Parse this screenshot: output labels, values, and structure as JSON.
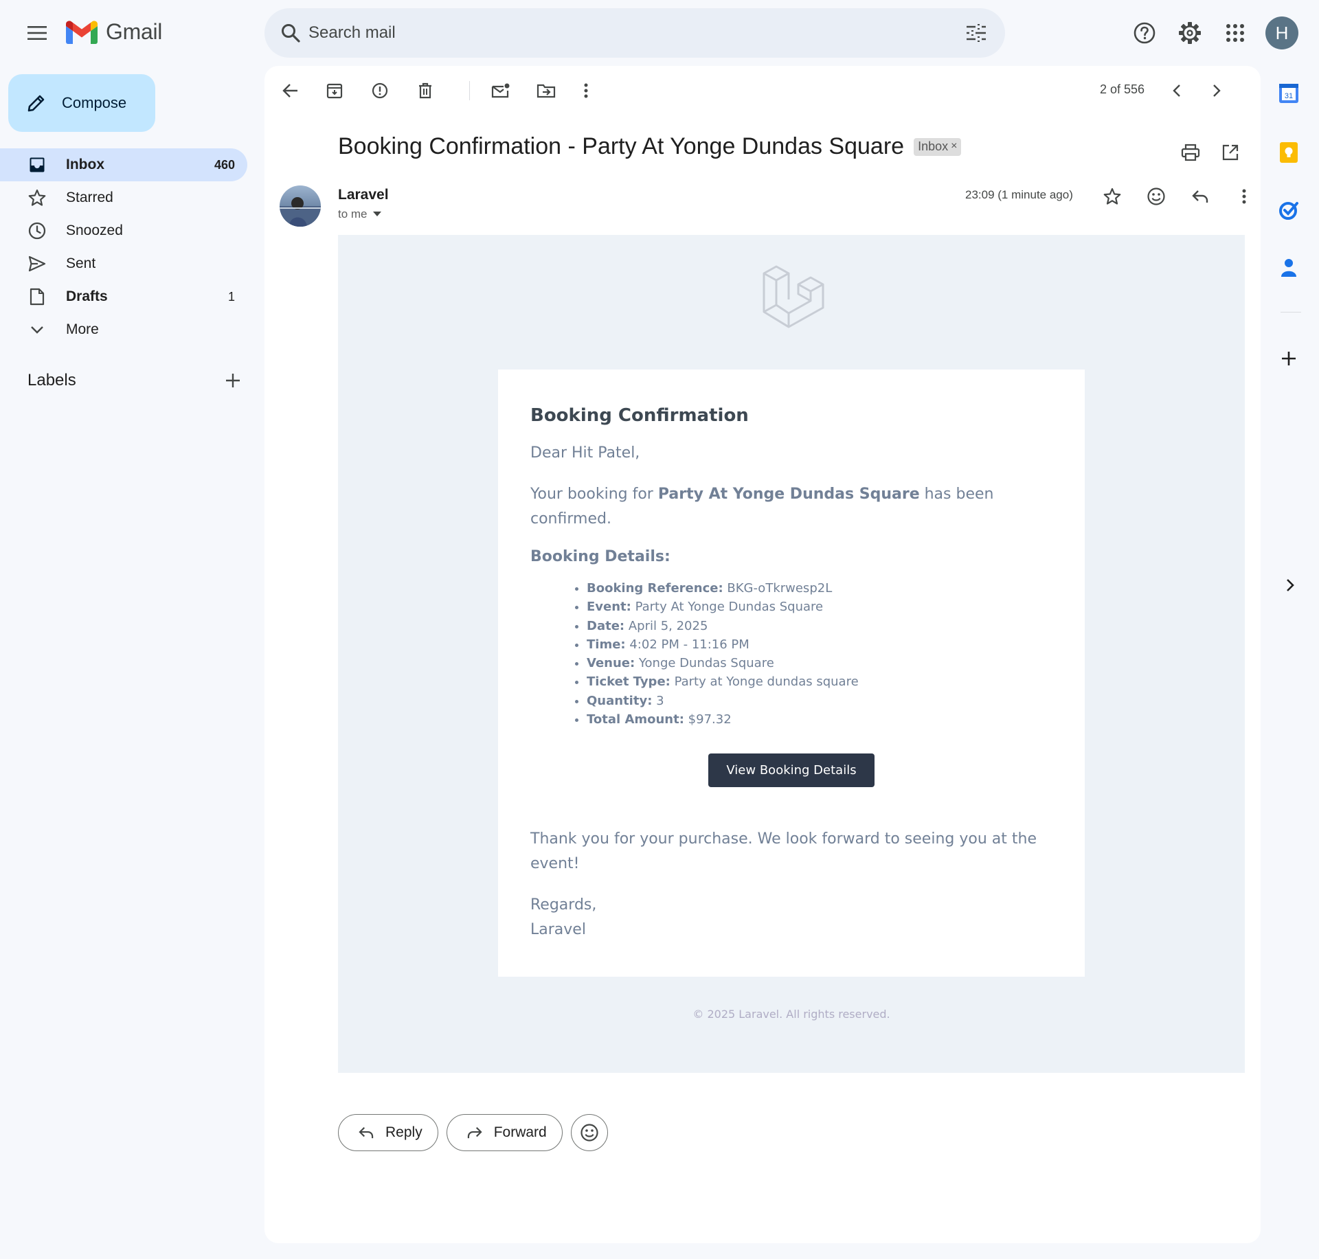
{
  "app": {
    "name": "Gmail"
  },
  "search": {
    "placeholder": "Search mail"
  },
  "account": {
    "initial": "H"
  },
  "compose": {
    "label": "Compose"
  },
  "nav": {
    "items": [
      {
        "label": "Inbox",
        "count": "460"
      },
      {
        "label": "Starred",
        "count": ""
      },
      {
        "label": "Snoozed",
        "count": ""
      },
      {
        "label": "Sent",
        "count": ""
      },
      {
        "label": "Drafts",
        "count": "1"
      },
      {
        "label": "More",
        "count": ""
      }
    ]
  },
  "labels": {
    "title": "Labels"
  },
  "toolbar": {
    "pager": "2 of 556"
  },
  "message": {
    "subject": "Booking Confirmation - Party At Yonge Dundas Square",
    "label_chip": "Inbox",
    "chip_close": "×",
    "sender": "Laravel",
    "to": "to me",
    "time": "23:09 (1 minute ago)"
  },
  "email": {
    "heading": "Booking Confirmation",
    "greeting": "Dear Hit Patel,",
    "intro_before": "Your booking for ",
    "intro_event": "Party At Yonge Dundas Square",
    "intro_after": " has been confirmed.",
    "details_heading": "Booking Details:",
    "details": [
      {
        "label": "Booking Reference:",
        "value": " BKG-oTkrwesp2L"
      },
      {
        "label": "Event:",
        "value": " Party At Yonge Dundas Square"
      },
      {
        "label": "Date:",
        "value": " April 5, 2025"
      },
      {
        "label": "Time:",
        "value": " 4:02 PM - 11:16 PM"
      },
      {
        "label": "Venue:",
        "value": " Yonge Dundas Square"
      },
      {
        "label": "Ticket Type:",
        "value": " Party at Yonge dundas square"
      },
      {
        "label": "Quantity:",
        "value": " 3"
      },
      {
        "label": "Total Amount:",
        "value": " $97.32"
      }
    ],
    "button_label": "View Booking Details",
    "thanks": "Thank you for your purchase. We look forward to seeing you at the event!",
    "regards": "Regards,",
    "signature": "Laravel",
    "footer": "© 2025 Laravel. All rights reserved."
  },
  "actions": {
    "reply": "Reply",
    "forward": "Forward"
  },
  "sidepanel": {
    "calendar_day": "31"
  },
  "colors": {
    "background": "#f6f8fc",
    "compose": "#c2e7ff",
    "active_nav": "#d3e3fd",
    "email_bg": "#edf2f7",
    "button": "#2d3748",
    "avatar": "#5a7486"
  }
}
